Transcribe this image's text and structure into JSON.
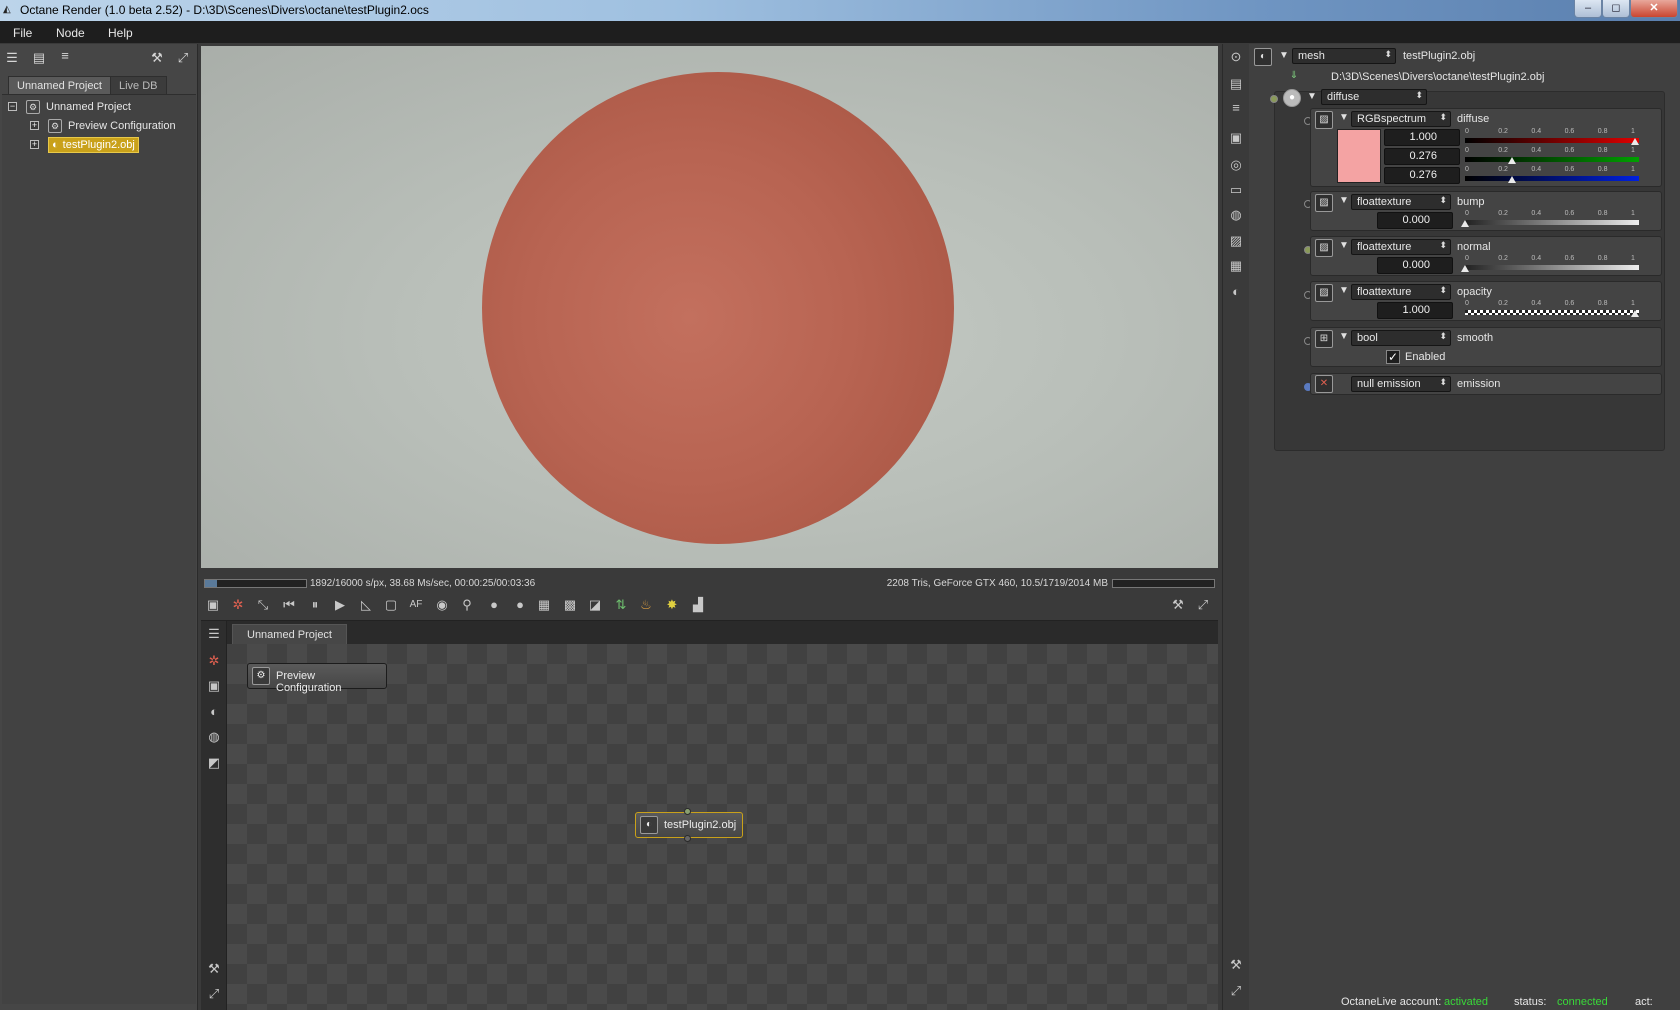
{
  "window": {
    "title": "Octane Render (1.0 beta 2.52) - D:\\3D\\Scenes\\Divers\\octane\\testPlugin2.ocs",
    "minimize": "–",
    "maximize": "◻",
    "close": "✕"
  },
  "menu": [
    "File",
    "Node",
    "Help"
  ],
  "scene_panel": {
    "tabs": [
      "Unnamed Project",
      "Live DB"
    ],
    "tree": {
      "root": "Unnamed Project",
      "children": [
        "Preview Configuration",
        "testPlugin2.obj"
      ],
      "selected": "testPlugin2.obj"
    }
  },
  "viewport": {
    "status_left": "1892/16000 s/px, 38.68 Ms/sec, 00:00:25/00:03:36",
    "status_right": "2208 Tris, GeForce GTX 460, 10.5/1719/2014 MB",
    "progress": 0.12
  },
  "graph": {
    "tab": "Unnamed Project",
    "nodes": [
      "Preview Configuration",
      "testPlugin2.obj"
    ]
  },
  "inspector": {
    "header_type": "mesh",
    "header_name": "testPlugin2.obj",
    "path": "D:\\3D\\Scenes\\Divers\\octane\\testPlugin2.obj",
    "material_type": "diffuse",
    "diffuse": {
      "type": "RGBspectrum",
      "label": "diffuse",
      "r": "1.000",
      "g": "0.276",
      "b": "0.276",
      "swatch_color": "#f4a3a3"
    },
    "bump": {
      "type": "floattexture",
      "label": "bump",
      "value": "0.000"
    },
    "normal": {
      "type": "floattexture",
      "label": "normal",
      "value": "0.000"
    },
    "opacity": {
      "type": "floattexture",
      "label": "opacity",
      "value": "1.000"
    },
    "smooth": {
      "type": "bool",
      "label": "smooth",
      "checkbox_label": "Enabled",
      "checked": true
    },
    "emission": {
      "type": "null emission",
      "label": "emission"
    },
    "slider_ticks": [
      "0",
      "0.2",
      "0.4",
      "0.6",
      "0.8",
      "1"
    ]
  },
  "status": {
    "account_label": "OctaneLive account:",
    "account_value": "activated",
    "status_label": "status:",
    "status_value": "connected",
    "act_label": "act:"
  },
  "colors": {
    "accent_selected": "#c9a11a",
    "status_green": "#39d839",
    "sphere": "#b86452"
  }
}
